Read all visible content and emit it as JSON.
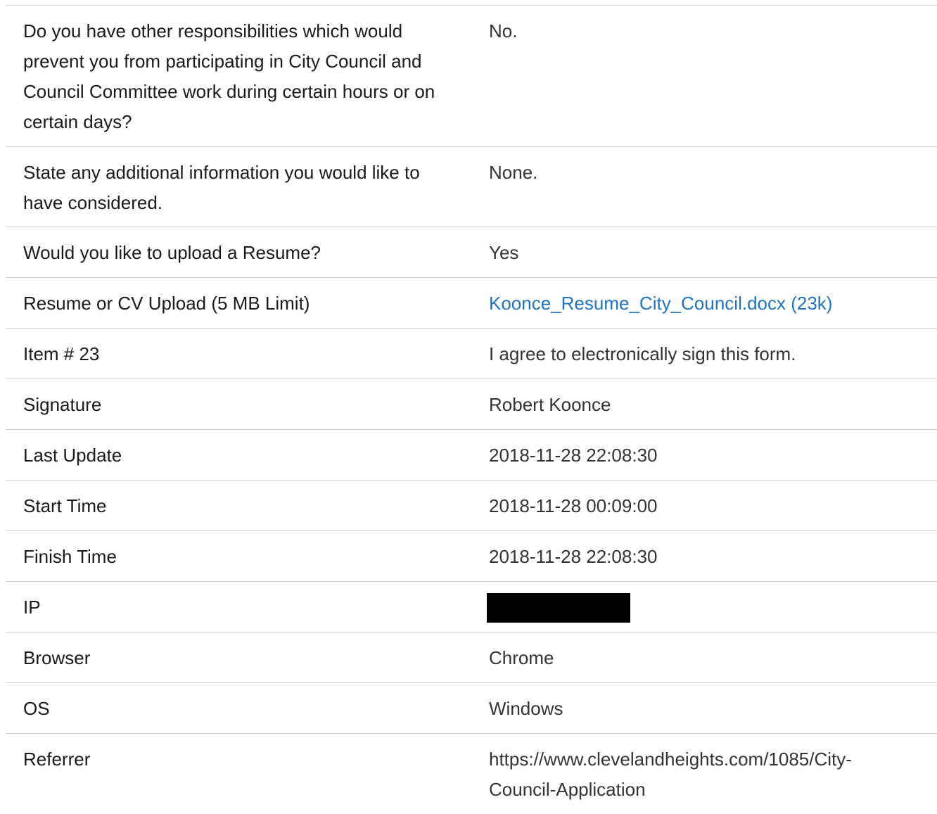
{
  "rows": [
    {
      "question": "Do you have other responsibilities which would prevent you from participating in City Council and Council Committee work during certain hours or on certain days?",
      "answer": "No."
    },
    {
      "question": "State any additional information you would like to have considered.",
      "answer": "None."
    },
    {
      "question": "Would you like to upload a Resume?",
      "answer": "Yes"
    },
    {
      "question": "Resume or CV Upload (5 MB Limit)",
      "answer": "Koonce_Resume_City_Council.docx (23k)"
    },
    {
      "question": "Item # 23",
      "answer": "I agree to electronically sign this form."
    },
    {
      "question": "Signature",
      "answer": "Robert Koonce"
    },
    {
      "question": "Last Update",
      "answer": "2018-11-28 22:08:30"
    },
    {
      "question": "Start Time",
      "answer": "2018-11-28 00:09:00"
    },
    {
      "question": "Finish Time",
      "answer": "2018-11-28 22:08:30"
    },
    {
      "question": "IP",
      "answer": ""
    },
    {
      "question": "Browser",
      "answer": "Chrome"
    },
    {
      "question": "OS",
      "answer": "Windows"
    },
    {
      "question": "Referrer",
      "answer": "https://www.clevelandheights.com/1085/City-Council-Application"
    }
  ],
  "colors": {
    "link": "#1f74bb",
    "divider": "#d3d3d3",
    "redaction": "#000000"
  }
}
